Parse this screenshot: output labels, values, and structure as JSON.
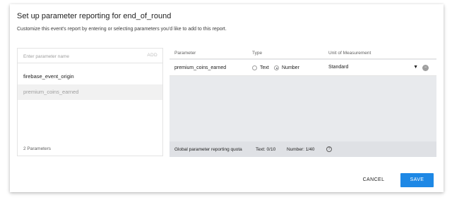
{
  "dialog": {
    "title": "Set up parameter reporting for end_of_round",
    "subtitle": "Customize this event's report by entering or selecting parameters you'd like to add to this report."
  },
  "left_panel": {
    "input": {
      "placeholder": "Enter parameter name",
      "value": ""
    },
    "add_label": "ADD",
    "items": [
      {
        "label": "firebase_event_origin",
        "state": "available"
      },
      {
        "label": "premium_coins_earned",
        "state": "selected"
      }
    ],
    "footer": "2 Parameters"
  },
  "right_panel": {
    "columns": {
      "parameter": "Parameter",
      "type": "Type",
      "unit": "Unit of Measurement"
    },
    "rows": [
      {
        "parameter": "premium_coins_earned",
        "type_options": [
          "Text",
          "Number"
        ],
        "type_selected": "Number",
        "unit": "Standard",
        "unit_caret_icon": "caret-down-icon",
        "remove_icon": "remove-icon"
      }
    ],
    "quota": {
      "label": "Global parameter reporting quota",
      "text": "Text: 0/10",
      "number": "Number: 1/40",
      "help_icon": "help-icon"
    }
  },
  "actions": {
    "cancel": "CANCEL",
    "save": "SAVE"
  },
  "colors": {
    "primary": "#1e88e5",
    "panel_bg": "#e8eaed",
    "quota_bg": "#dfe1e5",
    "selected_row_bg": "#f1f1f1"
  }
}
